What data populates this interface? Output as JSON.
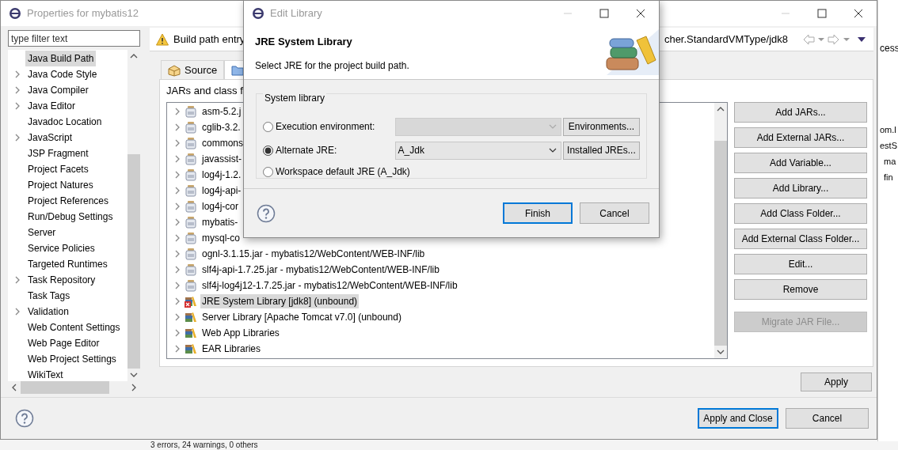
{
  "properties_window": {
    "title": "Properties for mybatis12",
    "filter": {
      "placeholder": "type filter text"
    },
    "nav_items": [
      {
        "label": "Java Build Path",
        "expandable": false,
        "selected": true
      },
      {
        "label": "Java Code Style",
        "expandable": true,
        "selected": false
      },
      {
        "label": "Java Compiler",
        "expandable": true,
        "selected": false
      },
      {
        "label": "Java Editor",
        "expandable": true,
        "selected": false
      },
      {
        "label": "Javadoc Location",
        "expandable": false,
        "selected": false
      },
      {
        "label": "JavaScript",
        "expandable": true,
        "selected": false
      },
      {
        "label": "JSP Fragment",
        "expandable": false,
        "selected": false
      },
      {
        "label": "Project Facets",
        "expandable": false,
        "selected": false
      },
      {
        "label": "Project Natures",
        "expandable": false,
        "selected": false
      },
      {
        "label": "Project References",
        "expandable": false,
        "selected": false
      },
      {
        "label": "Run/Debug Settings",
        "expandable": false,
        "selected": false
      },
      {
        "label": "Server",
        "expandable": false,
        "selected": false
      },
      {
        "label": "Service Policies",
        "expandable": false,
        "selected": false
      },
      {
        "label": "Targeted Runtimes",
        "expandable": false,
        "selected": false
      },
      {
        "label": "Task Repository",
        "expandable": true,
        "selected": false
      },
      {
        "label": "Task Tags",
        "expandable": false,
        "selected": false
      },
      {
        "label": "Validation",
        "expandable": true,
        "selected": false
      },
      {
        "label": "Web Content Settings",
        "expandable": false,
        "selected": false
      },
      {
        "label": "Web Page Editor",
        "expandable": false,
        "selected": false
      },
      {
        "label": "Web Project Settings",
        "expandable": false,
        "selected": false
      },
      {
        "label": "WikiText",
        "expandable": false,
        "selected": false
      }
    ],
    "header": {
      "message_start": "Build path entry",
      "message_end": "cher.StandardVMType/jdk8"
    },
    "tabs": [
      {
        "label": "Source",
        "selected": false
      },
      {
        "selected": true
      }
    ],
    "section_label": "JARs and class f",
    "entries": [
      {
        "label": "asm-5.2.j",
        "kind": "jar",
        "selected": false,
        "error": false
      },
      {
        "label": "cglib-3.2.",
        "kind": "jar",
        "selected": false,
        "error": false
      },
      {
        "label": "commons",
        "kind": "jar",
        "selected": false,
        "error": false
      },
      {
        "label": "javassist-",
        "kind": "jar",
        "selected": false,
        "error": false
      },
      {
        "label": "log4j-1.2.",
        "kind": "jar",
        "selected": false,
        "error": false
      },
      {
        "label": "log4j-api-",
        "kind": "jar",
        "selected": false,
        "error": false
      },
      {
        "label": "log4j-cor",
        "kind": "jar",
        "selected": false,
        "error": false
      },
      {
        "label": "mybatis-",
        "kind": "jar",
        "selected": false,
        "error": false
      },
      {
        "label": "mysql-co",
        "kind": "jar",
        "selected": false,
        "error": false
      },
      {
        "label": "ognl-3.1.15.jar - mybatis12/WebContent/WEB-INF/lib",
        "kind": "jar",
        "selected": false,
        "error": false
      },
      {
        "label": "slf4j-api-1.7.25.jar - mybatis12/WebContent/WEB-INF/lib",
        "kind": "jar",
        "selected": false,
        "error": false
      },
      {
        "label": "slf4j-log4j12-1.7.25.jar - mybatis12/WebContent/WEB-INF/lib",
        "kind": "jar",
        "selected": false,
        "error": false
      },
      {
        "label": "JRE System Library [jdk8] (unbound)",
        "kind": "library",
        "selected": true,
        "error": true
      },
      {
        "label": "Server Library [Apache Tomcat v7.0] (unbound)",
        "kind": "library",
        "selected": false,
        "error": false
      },
      {
        "label": "Web App Libraries",
        "kind": "library",
        "selected": false,
        "error": false
      },
      {
        "label": "EAR Libraries",
        "kind": "library",
        "selected": false,
        "error": false
      }
    ],
    "side_buttons": [
      {
        "label": "Add JARs...",
        "disabled": false
      },
      {
        "label": "Add External JARs...",
        "disabled": false
      },
      {
        "label": "Add Variable...",
        "disabled": false
      },
      {
        "label": "Add Library...",
        "disabled": false
      },
      {
        "label": "Add Class Folder...",
        "disabled": false
      },
      {
        "label": "Add External Class Folder...",
        "disabled": false
      },
      {
        "label": "Edit...",
        "disabled": false
      },
      {
        "label": "Remove",
        "disabled": false
      },
      {
        "label": "Migrate JAR File...",
        "disabled": true
      }
    ],
    "apply": "Apply",
    "footer_buttons": [
      {
        "label": "Apply and Close",
        "default": true
      },
      {
        "label": "Cancel",
        "default": false
      }
    ]
  },
  "dialog": {
    "title": "Edit Library",
    "heading": "JRE System Library",
    "description": "Select JRE for the project build path.",
    "group_label": "System library",
    "options": [
      {
        "label": "Execution environment:",
        "selected": false,
        "combo": {
          "disabled": true
        },
        "button": "Environments..."
      },
      {
        "label": "Alternate JRE:",
        "selected": true,
        "combo": {
          "value": "A_Jdk",
          "disabled": false
        },
        "button": "Installed JREs..."
      },
      {
        "label": "Workspace default JRE (A_Jdk)",
        "selected": false
      }
    ],
    "buttons": [
      {
        "label": "Finish",
        "default": true
      },
      {
        "label": "Cancel",
        "default": false
      }
    ]
  },
  "background": {
    "tab_fragment": "cess",
    "outline": [
      "om.l",
      "estS",
      "ma",
      "fin"
    ],
    "status": "3 errors, 24 warnings, 0 others"
  }
}
